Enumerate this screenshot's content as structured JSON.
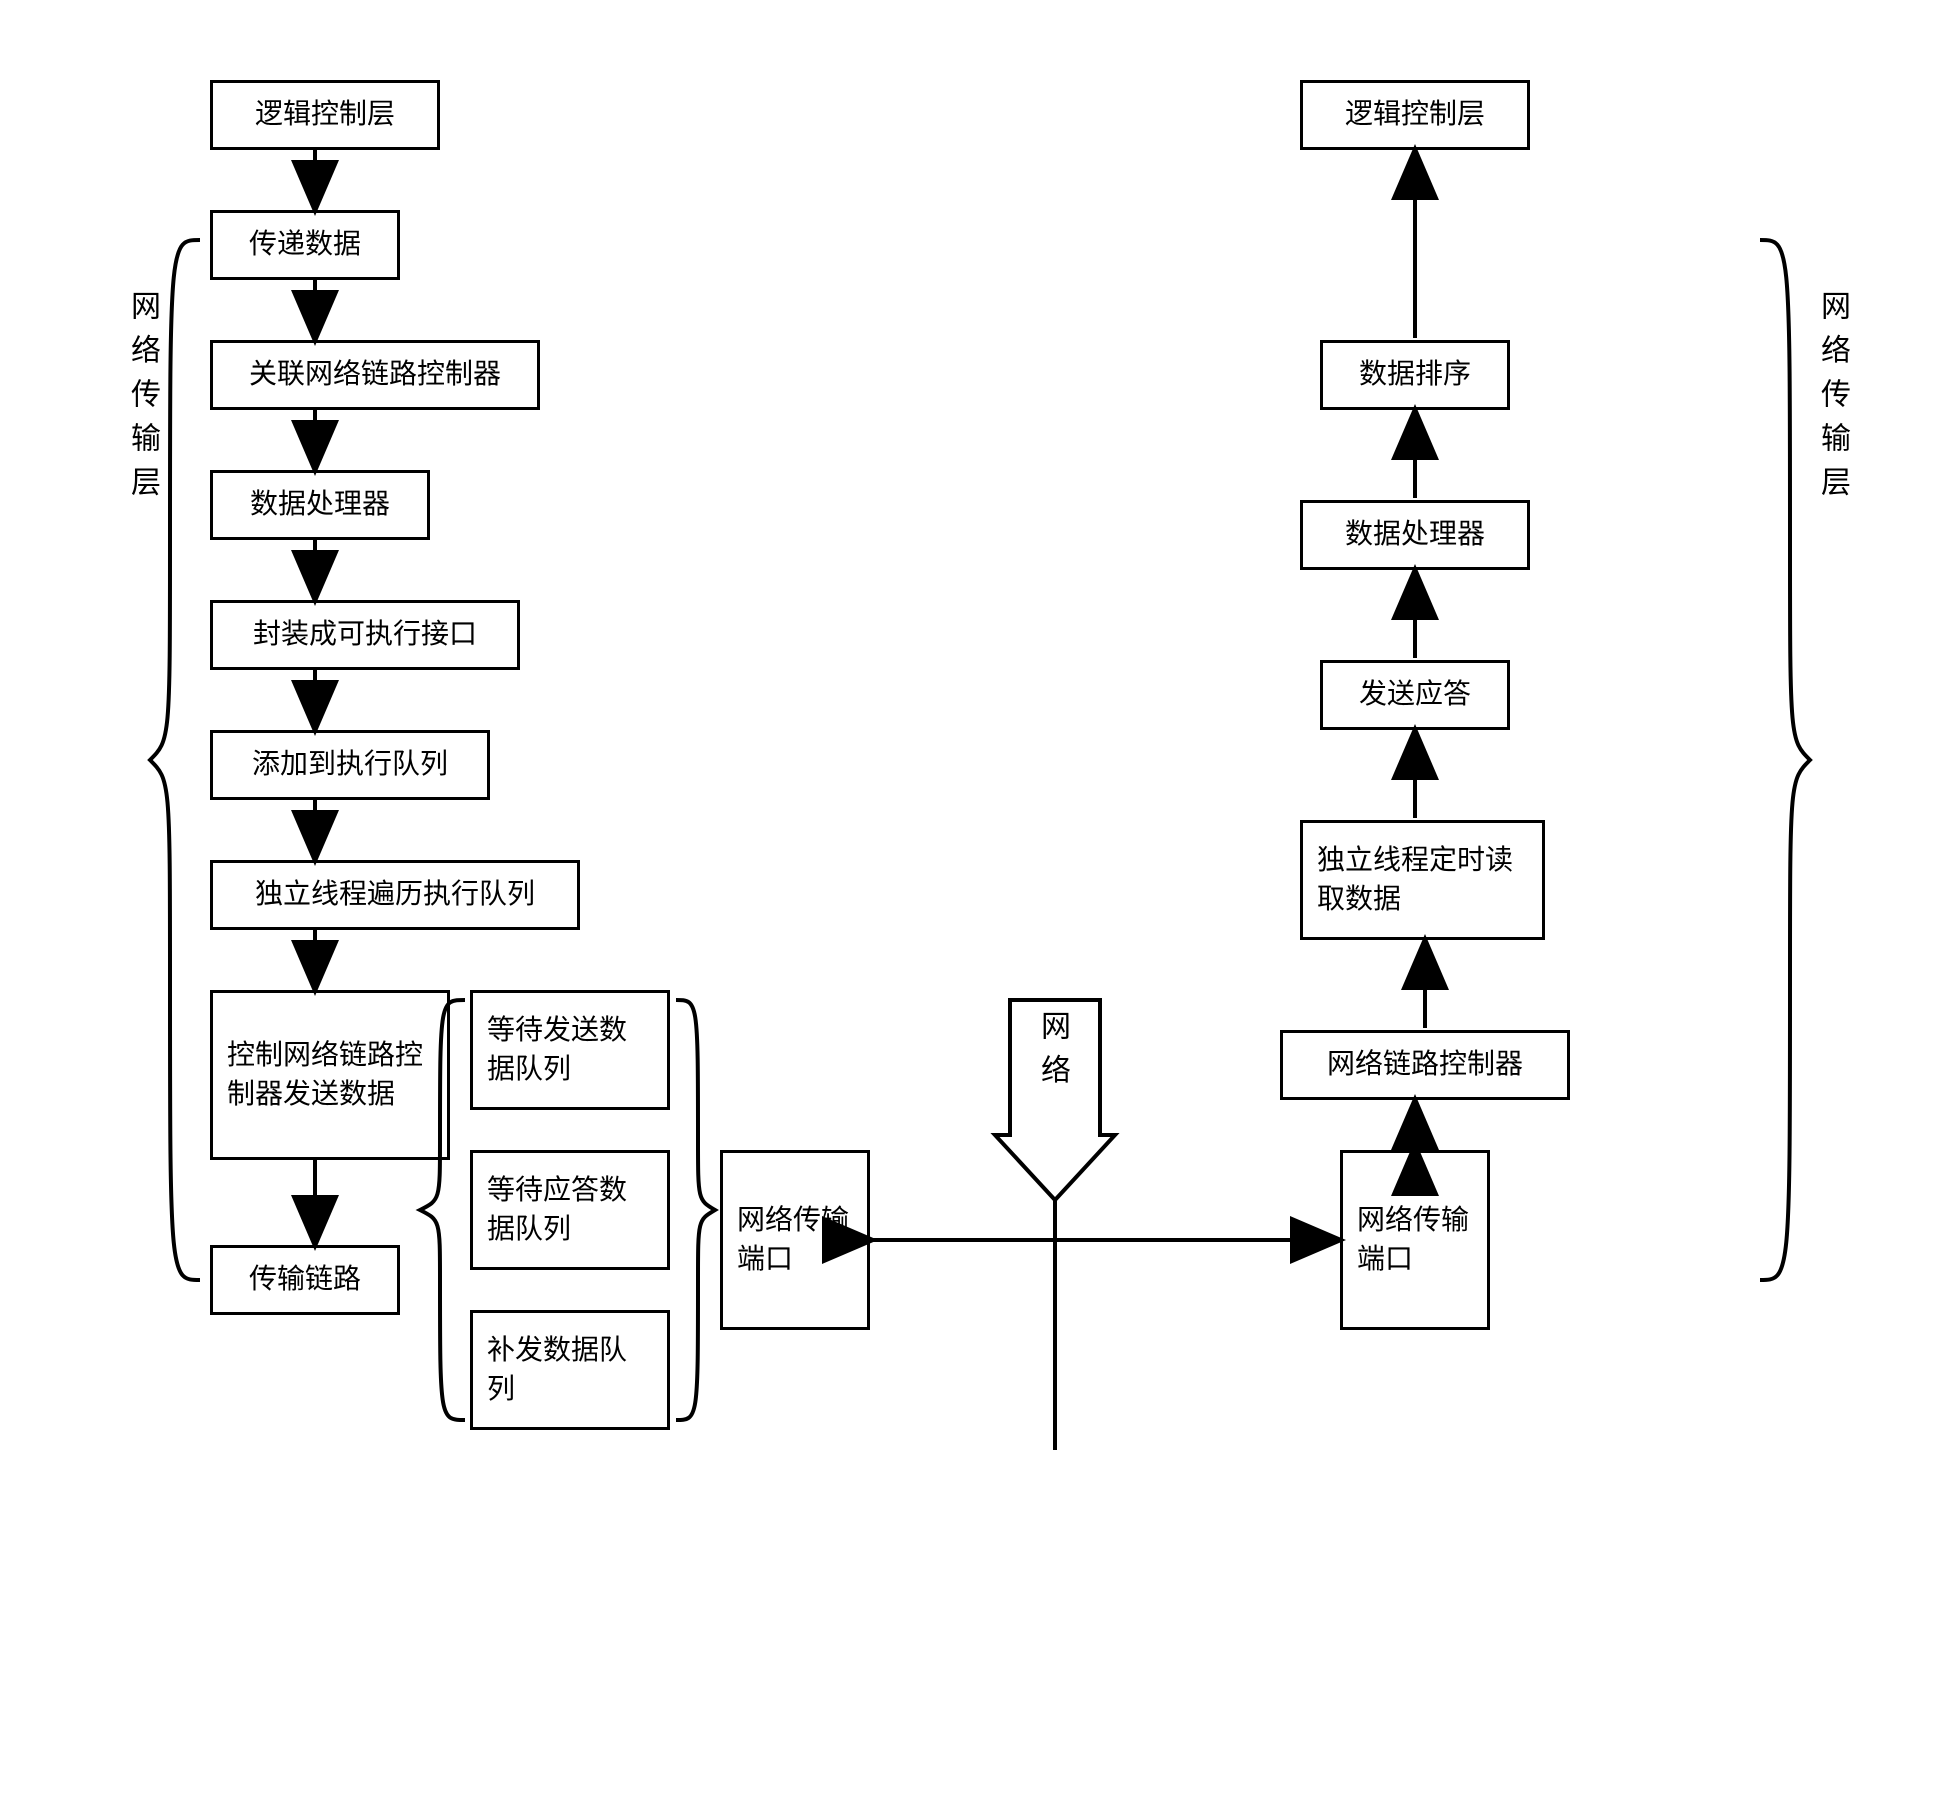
{
  "left": {
    "layerLabel": "网络传输层",
    "n1": "逻辑控制层",
    "n2": "传递数据",
    "n3": "关联网络链路控制器",
    "n4": "数据处理器",
    "n5": "封装成可执行接口",
    "n6": "添加到执行队列",
    "n7": "独立线程遍历执行队列",
    "n8": "控制网络链路控制器发送数据",
    "n9": "传输链路",
    "q1": "等待发送数据队列",
    "q2": "等待应答数据队列",
    "q3": "补发数据队列",
    "port": "网络传输端口"
  },
  "mid": {
    "network": "网络"
  },
  "right": {
    "layerLabel": "网络传输层",
    "r1": "逻辑控制层",
    "r2": "数据排序",
    "r3": "数据处理器",
    "r4": "发送应答",
    "r5": "独立线程定时读取数据",
    "r6": "网络链路控制器",
    "port": "网络传输端口"
  }
}
